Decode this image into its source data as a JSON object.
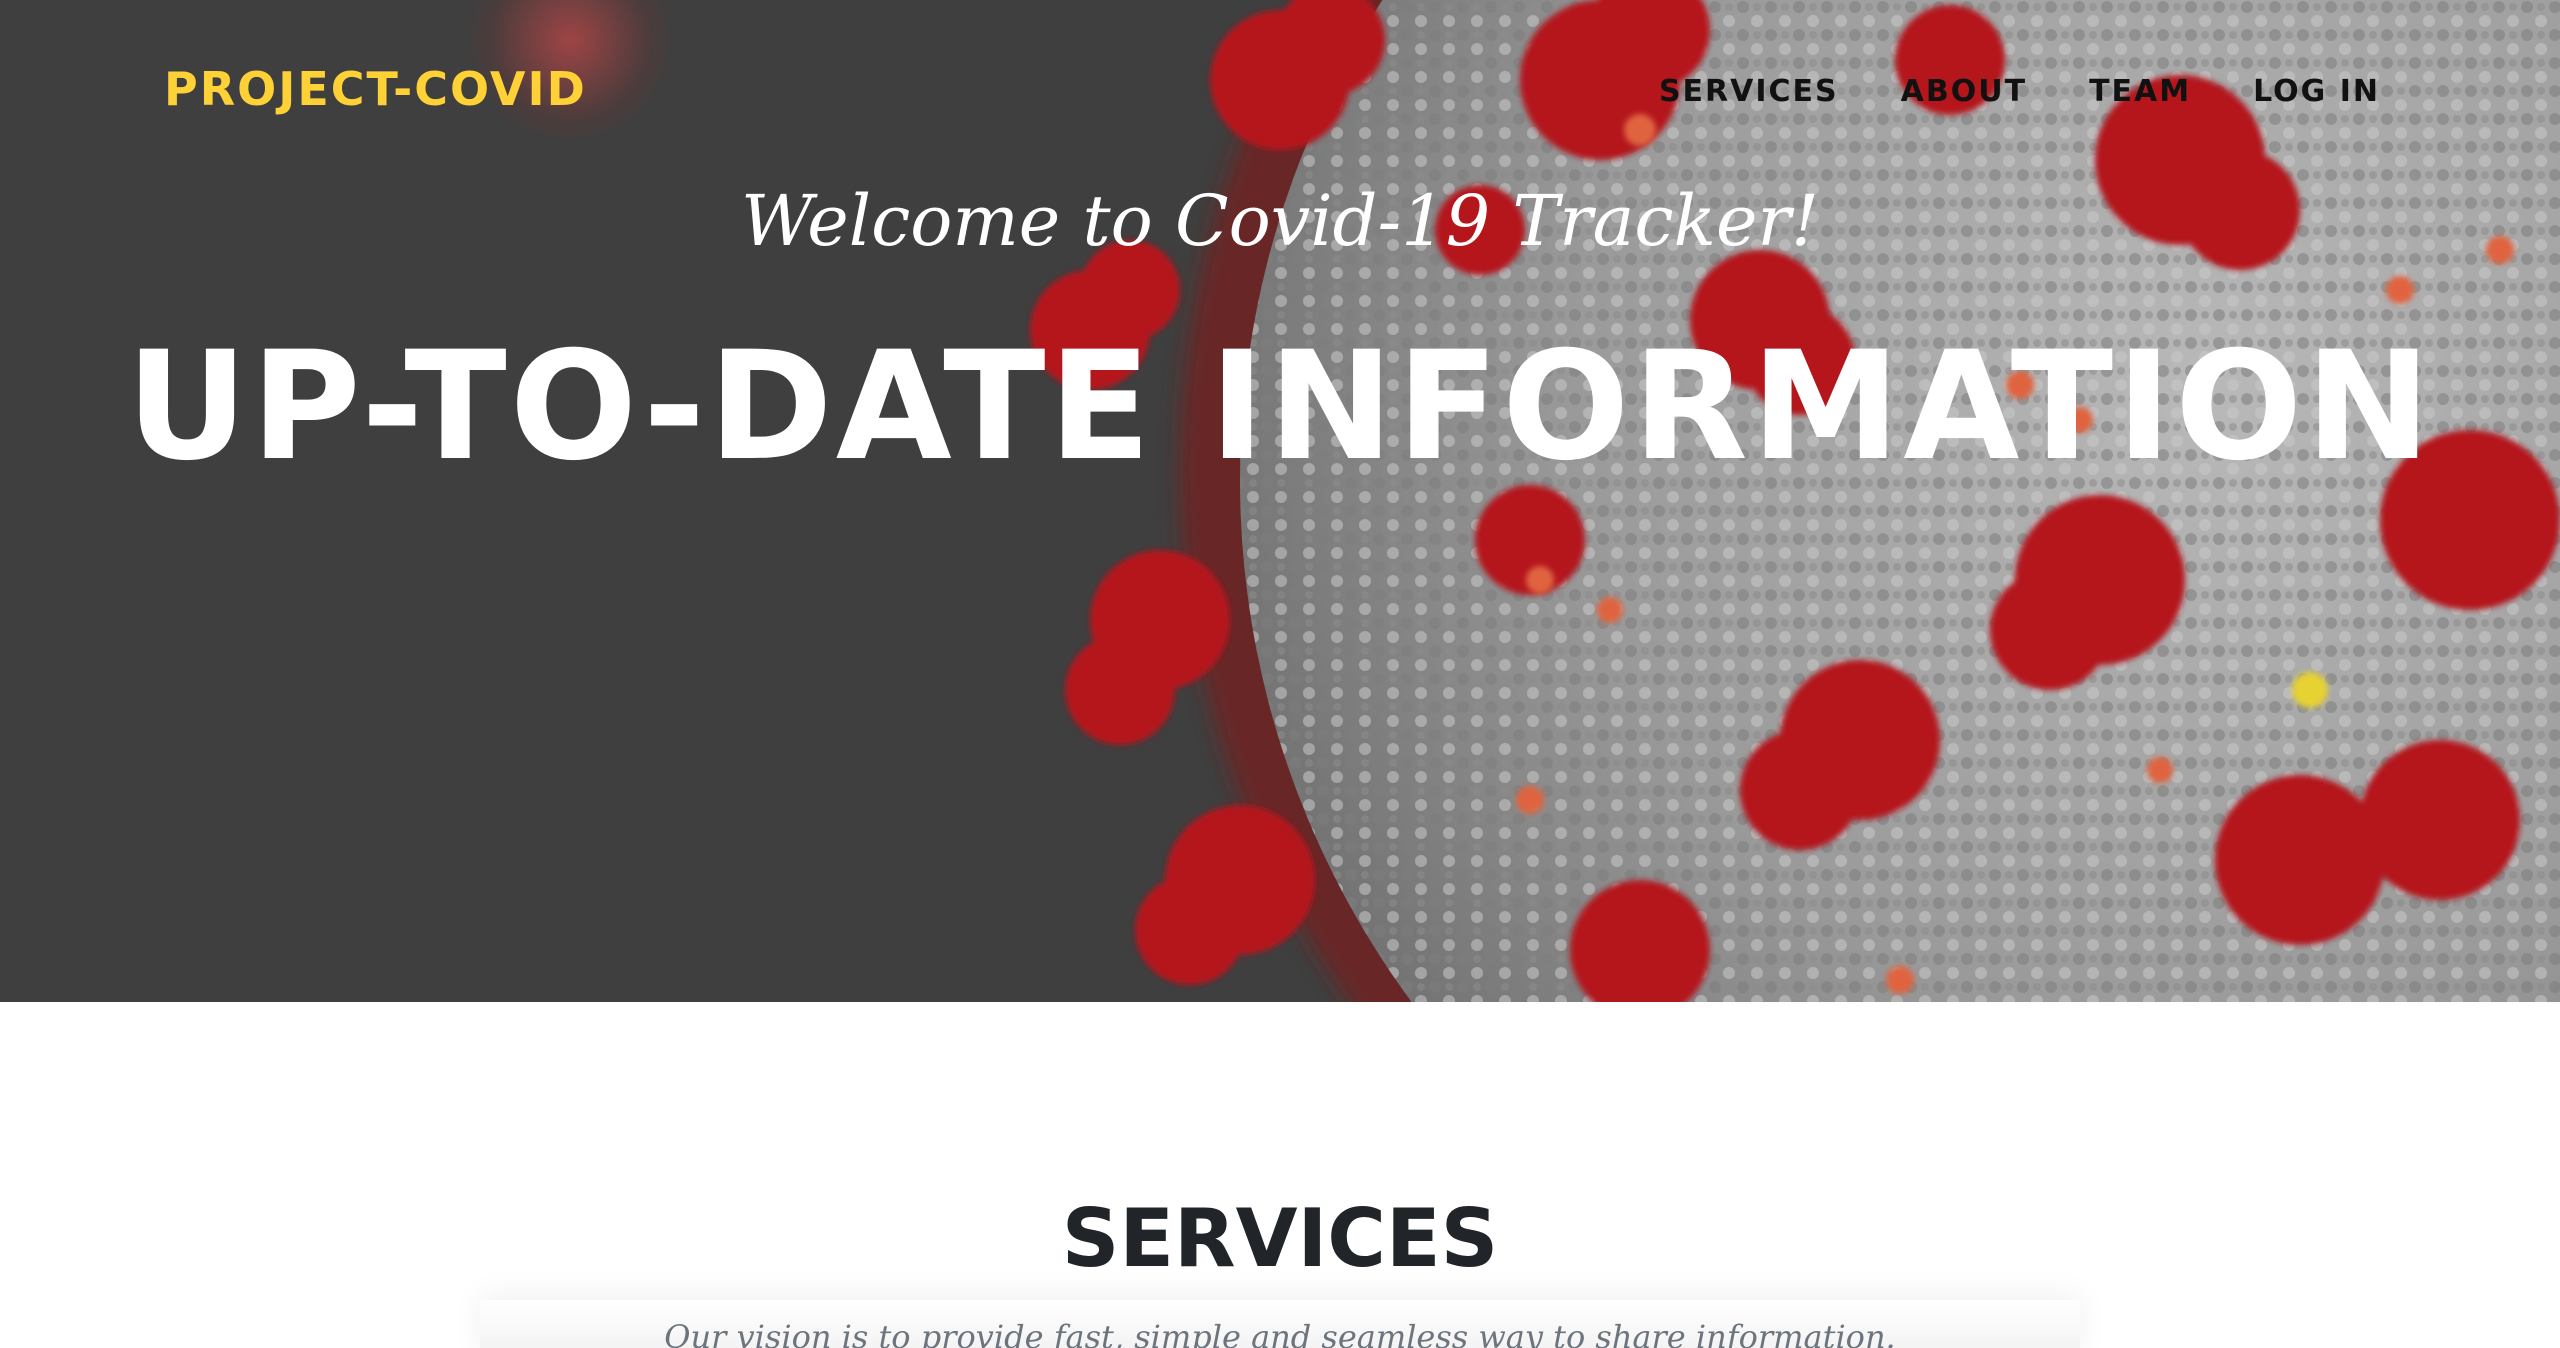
{
  "brand": {
    "name": "PROJECT-COVID"
  },
  "nav": {
    "items": [
      "SERVICES",
      "ABOUT",
      "TEAM",
      "LOG IN"
    ]
  },
  "hero": {
    "welcome": "Welcome to Covid-19 Tracker!",
    "headline": "UP-TO-DATE INFORMATION",
    "image": "coronavirus-illustration"
  },
  "services": {
    "title": "SERVICES",
    "subtitle": "Our vision is to provide fast, simple and seamless way to share information."
  },
  "colors": {
    "brand": "#fed136",
    "hero_background": "#3f3f3f",
    "virus_spike": "#b4151f",
    "virus_body": "#9a9a9a",
    "heading_text": "#212529"
  }
}
